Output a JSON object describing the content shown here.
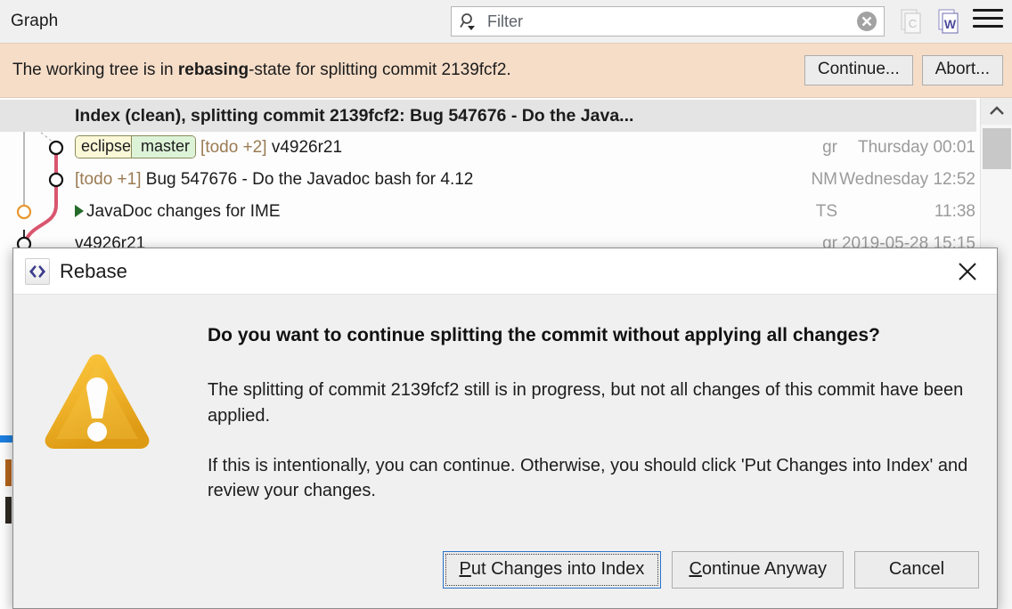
{
  "toolbar": {
    "view_title": "Graph",
    "search": {
      "placeholder": "Filter",
      "value": "",
      "icon": "search-filter-icon",
      "clear_icon": "clear-icon"
    },
    "icons": [
      {
        "name": "copy-commit-icon",
        "glyph": "C",
        "enabled": false
      },
      {
        "name": "wrap-text-icon",
        "glyph": "W",
        "enabled": true
      },
      {
        "name": "view-menu-icon",
        "glyph": "hamburger",
        "enabled": true
      }
    ]
  },
  "banner": {
    "text_prefix": "The working tree is in ",
    "text_bold": "rebasing",
    "text_suffix": "-state for splitting commit 2139fcf2.",
    "background": "#f5ddc8",
    "buttons": [
      {
        "name": "continue-button",
        "label": "Continue..."
      },
      {
        "name": "abort-button",
        "label": "Abort..."
      }
    ]
  },
  "graph": {
    "rows": [
      {
        "message": "Index (clean), splitting commit 2139fcf2: Bug 547676 - Do the Java...",
        "author": "",
        "date": "",
        "selected": true,
        "bold": true,
        "node": {
          "color": "#5fa85f",
          "filled": false
        },
        "refs": []
      },
      {
        "message_todo": "[todo +2]",
        "message": "v4926r21",
        "author": "gr",
        "date": "Thursday 00:01",
        "selected": false,
        "bold": false,
        "node": {
          "color": "#111111",
          "filled": false
        },
        "refs": [
          {
            "name": "eclipse",
            "type": "remote",
            "color": "#fbf8d8"
          },
          {
            "name": "master",
            "type": "local",
            "color": "#ddf3d8"
          }
        ]
      },
      {
        "message_todo": "[todo +1]",
        "message": "Bug 547676 - Do the Javadoc bash for 4.12",
        "author": "NM",
        "date": "Wednesday 12:52",
        "selected": false,
        "bold": false,
        "node": {
          "color": "#111111",
          "filled": false
        },
        "refs": []
      },
      {
        "message": "JavaDoc changes for IME",
        "has_play": true,
        "author": "TS",
        "date": "11:38",
        "selected": false,
        "bold": false,
        "node": {
          "color": "#e8962e",
          "filled": false
        },
        "refs": []
      },
      {
        "message": "v4926r21",
        "author": "gr",
        "date": "2019-05-28 15:15",
        "selected": false,
        "bold": false,
        "node": {
          "color": "#111111",
          "filled": false
        },
        "refs": []
      }
    ],
    "lane_colors": {
      "main": "#aaaaaa",
      "branch": "#d9566f",
      "dotted": "#b8b8b8"
    },
    "scrollbar": {
      "up_icon": "chevron-up-icon"
    }
  },
  "dialog": {
    "title": "Rebase",
    "title_icon": "eclipse-code-icon",
    "close_icon": "close-icon",
    "warning_icon": "warning-triangle-icon",
    "heading": "Do you want to continue splitting the commit without applying all changes?",
    "paragraph_1": "The splitting of commit 2139fcf2 still is in progress, but not all changes of this commit have been applied.",
    "paragraph_2": "If this is intentionally, you can continue. Otherwise, you should click 'Put Changes into Index' and review your changes.",
    "buttons": [
      {
        "name": "put-changes-into-index-button",
        "label_pre": "",
        "mnemonic": "P",
        "label_post": "ut Changes into Index",
        "focused": true
      },
      {
        "name": "continue-anyway-button",
        "label_pre": "",
        "mnemonic": "C",
        "label_post": "ontinue Anyway",
        "focused": false
      },
      {
        "name": "cancel-button",
        "label_pre": "Cancel",
        "mnemonic": "",
        "label_post": "",
        "focused": false
      }
    ]
  }
}
